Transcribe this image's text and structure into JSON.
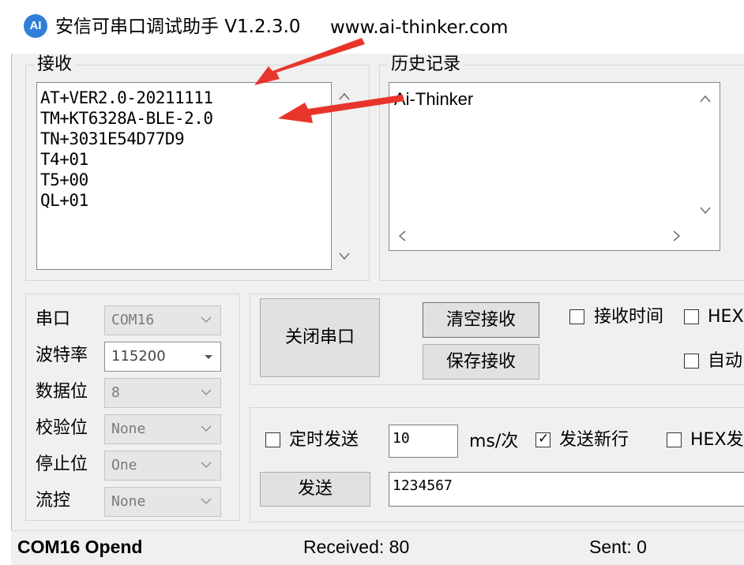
{
  "window": {
    "icon_text": "AI",
    "title": "安信可串口调试助手 V1.2.3.0",
    "url": "www.ai-thinker.com"
  },
  "receive": {
    "legend": "接收",
    "lines": [
      "AT+VER2.0-20211111",
      "TM+KT6328A-BLE-2.0",
      "TN+3031E54D77D9",
      "T4+01",
      "T5+00",
      "QL+01"
    ]
  },
  "history": {
    "legend": "历史记录",
    "items": [
      "Ai-Thinker"
    ]
  },
  "settings": {
    "port_label": "串口",
    "port_value": "COM16",
    "baud_label": "波特率",
    "baud_value": "115200",
    "databits_label": "数据位",
    "databits_value": "8",
    "parity_label": "校验位",
    "parity_value": "None",
    "stopbits_label": "停止位",
    "stopbits_value": "One",
    "flow_label": "流控",
    "flow_value": "None"
  },
  "controls": {
    "close_port": "关闭串口",
    "clear_receive": "清空接收",
    "save_receive": "保存接收",
    "recv_time_label": "接收时间",
    "hex_display_label": "HEX显",
    "auto_label": "自动",
    "recv_time_checked": false,
    "hex_display_checked": false,
    "auto_checked": false
  },
  "send": {
    "timed_send_label": "定时发送",
    "timed_send_checked": false,
    "interval_value": "10",
    "interval_unit": "ms/次",
    "send_newline_label": "发送新行",
    "send_newline_checked": true,
    "hex_send_label": "HEX发送",
    "hex_send_checked": false,
    "send_button": "发送",
    "send_text": "1234567"
  },
  "status": {
    "port_state": "COM16 Opend",
    "received": "Received: 80",
    "sent": "Sent: 0"
  },
  "colors": {
    "annotation_arrow": "#e8352b",
    "icon_blue": "#2f7fd8"
  }
}
